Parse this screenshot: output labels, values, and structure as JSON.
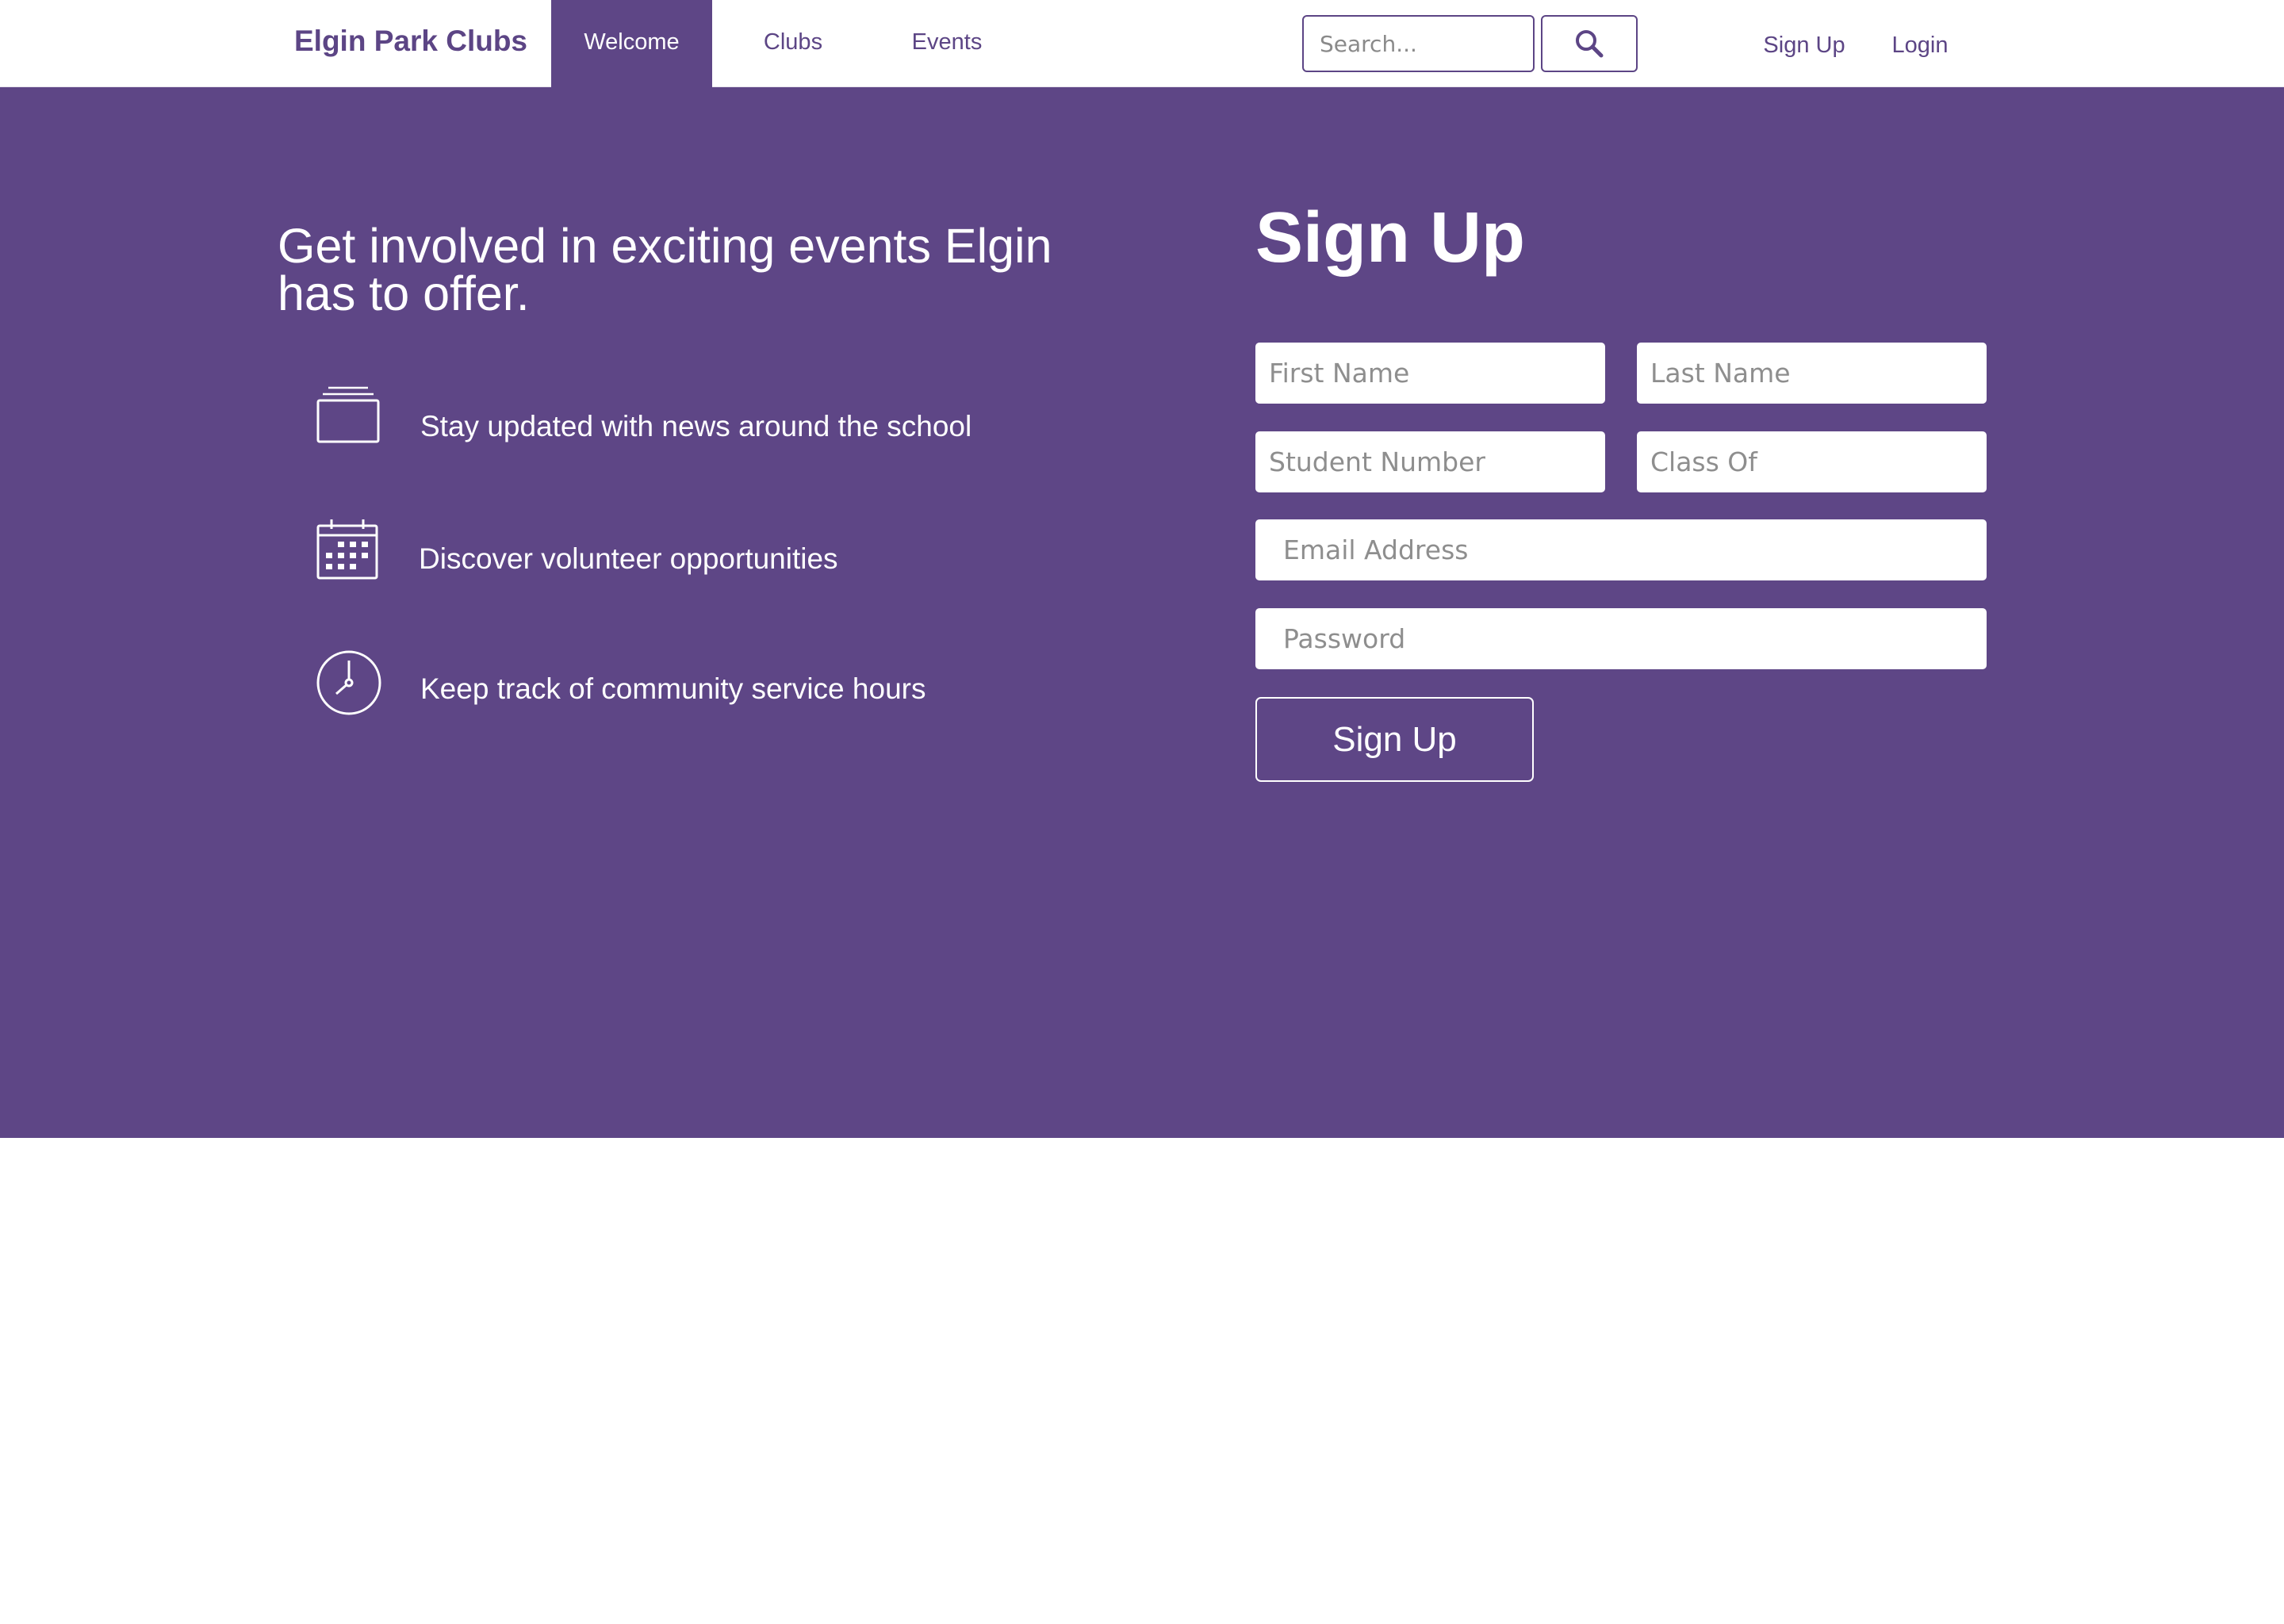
{
  "nav": {
    "brand": "Elgin Park Clubs",
    "links": [
      {
        "label": "Welcome",
        "active": true
      },
      {
        "label": "Clubs",
        "active": false
      },
      {
        "label": "Events",
        "active": false
      }
    ],
    "search": {
      "placeholder": "Search...",
      "button_icon": "search-icon"
    },
    "auth": {
      "signup": "Sign Up",
      "login": "Login"
    }
  },
  "hero": {
    "tagline": "Get involved in exciting events Elgin has to offer.",
    "features": [
      {
        "icon": "news-cards-icon",
        "text": "Stay updated with news around the school"
      },
      {
        "icon": "calendar-icon",
        "text": "Discover volunteer opportunities"
      },
      {
        "icon": "clock-icon",
        "text": "Keep track of community service hours"
      }
    ]
  },
  "signup_form": {
    "title": "Sign Up",
    "fields": {
      "first_name": "First Name",
      "last_name": "Last Name",
      "student_number": "Student Number",
      "class_of": "Class Of",
      "email": "Email Address",
      "password": "Password"
    },
    "submit_label": "Sign Up"
  },
  "colors": {
    "brand_purple": "#5e4686",
    "text_purple": "#5c4585",
    "white": "#ffffff"
  }
}
